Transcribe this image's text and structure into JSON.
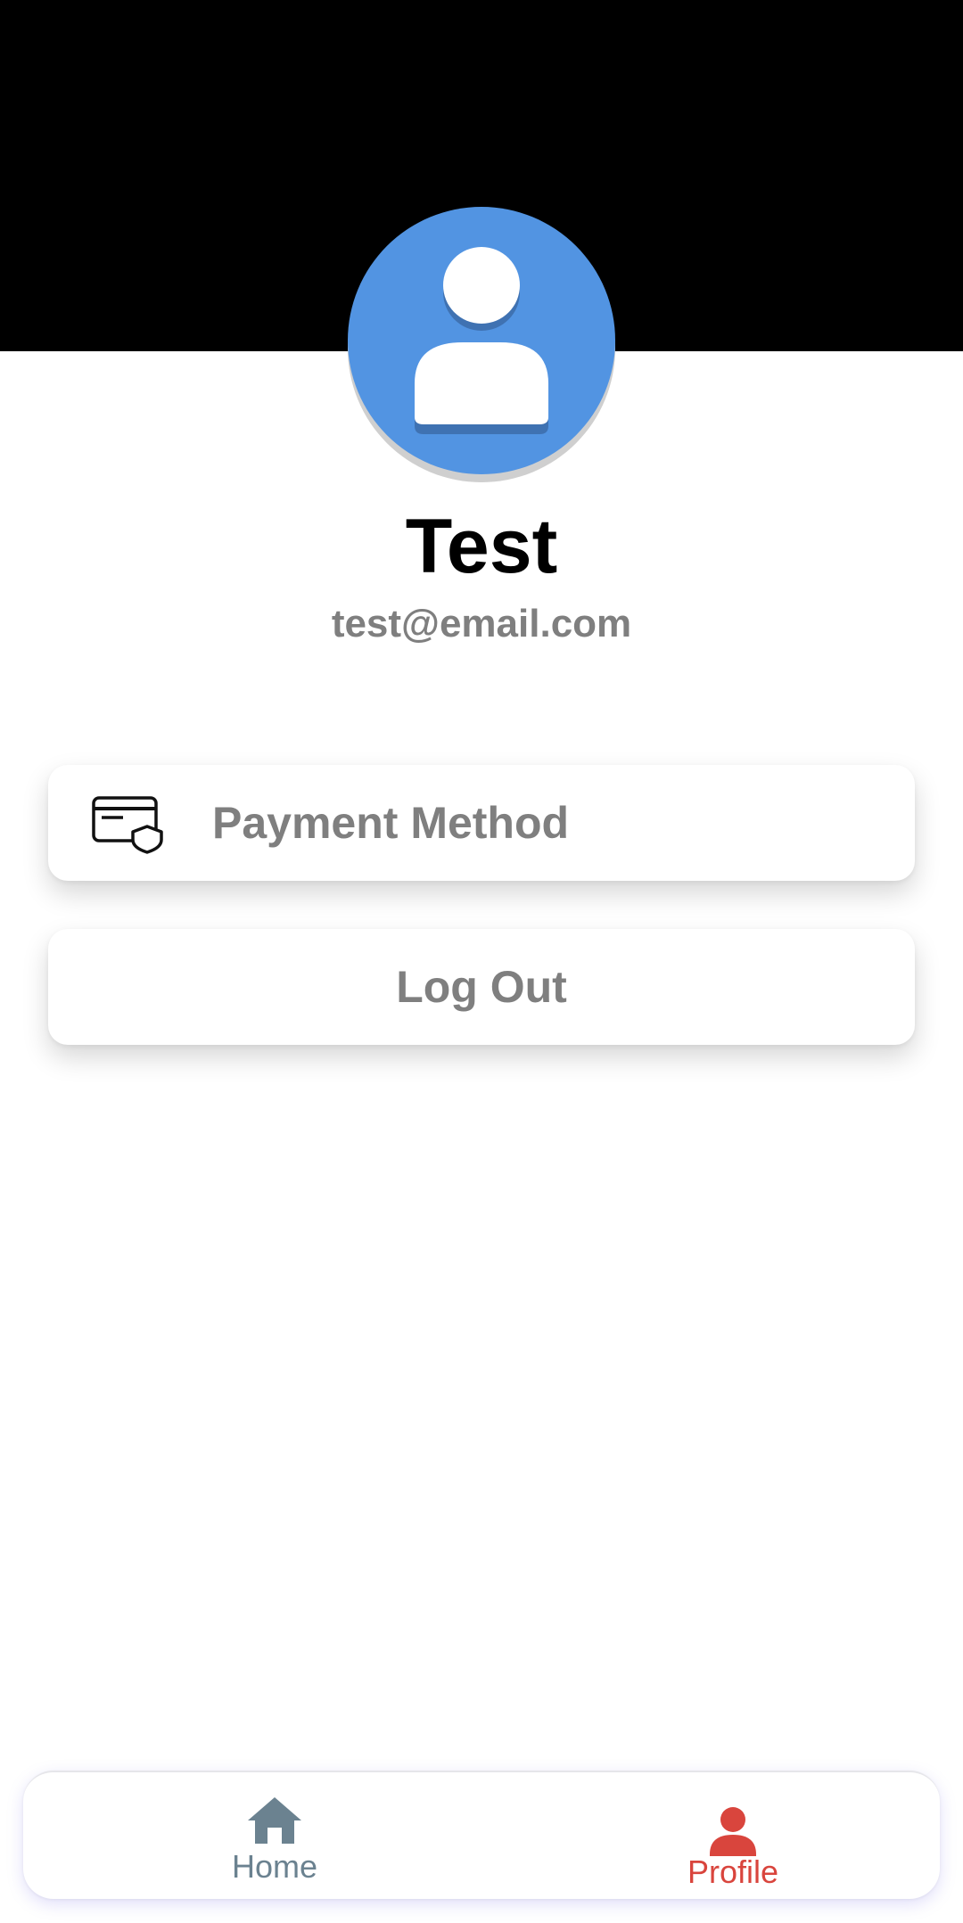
{
  "profile": {
    "name": "Test",
    "email": "test@email.com",
    "avatar_icon": "user-avatar-icon",
    "avatar_color": "#5294e2"
  },
  "actions": {
    "payment_label": "Payment Method",
    "payment_icon": "credit-card-shield-icon",
    "logout_label": "Log Out"
  },
  "bottom_nav": {
    "items": [
      {
        "label": "Home",
        "icon": "home-icon",
        "active": false,
        "color": "#6b8290"
      },
      {
        "label": "Profile",
        "icon": "person-icon",
        "active": true,
        "color": "#d9453d"
      }
    ]
  },
  "colors": {
    "header_band": "#000000",
    "text_muted": "#7f7f7f"
  }
}
